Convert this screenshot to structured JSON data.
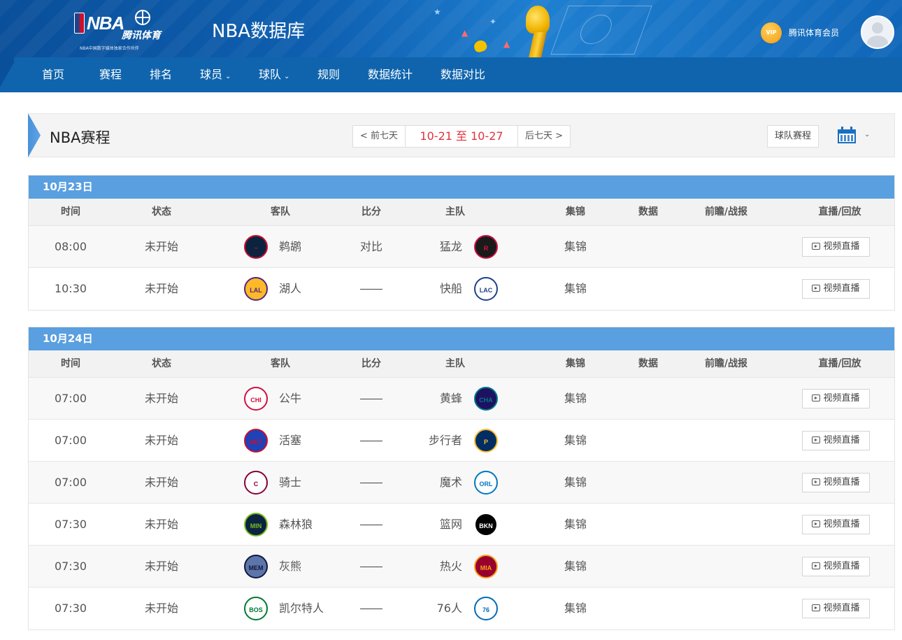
{
  "header": {
    "logo_nba": "NBA",
    "logo_partner": "腾讯体育",
    "logo_sub": "NBA中国数字媒体独家合作伙伴",
    "site_title": "NBA数据库",
    "vip_badge": "VIP",
    "vip_label": "腾讯体育会员"
  },
  "nav": [
    {
      "label": "首页",
      "caret": false
    },
    {
      "label": "赛程",
      "caret": false
    },
    {
      "label": "排名",
      "caret": false
    },
    {
      "label": "球员",
      "caret": true
    },
    {
      "label": "球队",
      "caret": true
    },
    {
      "label": "规则",
      "caret": false
    },
    {
      "label": "数据统计",
      "caret": false
    },
    {
      "label": "数据对比",
      "caret": false
    }
  ],
  "schedule": {
    "title": "NBA赛程",
    "prev_label": "< 前七天",
    "next_label": "后七天 >",
    "range": "10-21 至 10-27",
    "team_schedule_label": "球队赛程"
  },
  "columns": [
    "时间",
    "状态",
    "客队",
    "比分",
    "主队",
    "集锦",
    "数据",
    "前瞻/战报",
    "直播/回放"
  ],
  "days": [
    {
      "date": "10月23日",
      "games": [
        {
          "time": "08:00",
          "status": "未开始",
          "away": "鹈鹕",
          "away_logo": "pelicans-logo",
          "score": "对比",
          "home": "猛龙",
          "home_logo": "raptors-logo",
          "highlights": "集锦",
          "live": "视频直播"
        },
        {
          "time": "10:30",
          "status": "未开始",
          "away": "湖人",
          "away_logo": "lakers-logo",
          "score": "",
          "home": "快船",
          "home_logo": "clippers-logo",
          "highlights": "集锦",
          "live": "视频直播"
        }
      ]
    },
    {
      "date": "10月24日",
      "games": [
        {
          "time": "07:00",
          "status": "未开始",
          "away": "公牛",
          "away_logo": "bulls-logo",
          "score": "",
          "home": "黄蜂",
          "home_logo": "hornets-logo",
          "highlights": "集锦",
          "live": "视频直播"
        },
        {
          "time": "07:00",
          "status": "未开始",
          "away": "活塞",
          "away_logo": "pistons-logo",
          "score": "",
          "home": "步行者",
          "home_logo": "pacers-logo",
          "highlights": "集锦",
          "live": "视频直播"
        },
        {
          "time": "07:00",
          "status": "未开始",
          "away": "骑士",
          "away_logo": "cavaliers-logo",
          "score": "",
          "home": "魔术",
          "home_logo": "magic-logo",
          "highlights": "集锦",
          "live": "视频直播"
        },
        {
          "time": "07:30",
          "status": "未开始",
          "away": "森林狼",
          "away_logo": "timberwolves-logo",
          "score": "",
          "home": "篮网",
          "home_logo": "nets-logo",
          "highlights": "集锦",
          "live": "视频直播"
        },
        {
          "time": "07:30",
          "status": "未开始",
          "away": "灰熊",
          "away_logo": "grizzlies-logo",
          "score": "",
          "home": "热火",
          "home_logo": "heat-logo",
          "highlights": "集锦",
          "live": "视频直播"
        },
        {
          "time": "07:30",
          "status": "未开始",
          "away": "凯尔特人",
          "away_logo": "celtics-logo",
          "score": "",
          "home": "76人",
          "home_logo": "76ers-logo",
          "highlights": "集锦",
          "live": "视频直播"
        }
      ]
    }
  ],
  "team_colors": {
    "鹈鹕": {
      "bg": "#0c2340",
      "fg": "#c8102e",
      "mark": "~"
    },
    "猛龙": {
      "bg": "#1a1a1a",
      "fg": "#ce1141",
      "mark": "R"
    },
    "湖人": {
      "bg": "#fdb927",
      "fg": "#552583",
      "mark": "LAL"
    },
    "快船": {
      "bg": "#ffffff",
      "fg": "#1d428a",
      "mark": "LAC"
    },
    "公牛": {
      "bg": "#ffffff",
      "fg": "#ce1141",
      "mark": "CHI"
    },
    "黄蜂": {
      "bg": "#1d1160",
      "fg": "#00788c",
      "mark": "CHA"
    },
    "活塞": {
      "bg": "#1d42ba",
      "fg": "#c8102e",
      "mark": "DET"
    },
    "步行者": {
      "bg": "#002d62",
      "fg": "#fdbb30",
      "mark": "P"
    },
    "骑士": {
      "bg": "#ffffff",
      "fg": "#860038",
      "mark": "C"
    },
    "魔术": {
      "bg": "#ffffff",
      "fg": "#0077c0",
      "mark": "ORL"
    },
    "森林狼": {
      "bg": "#0c2340",
      "fg": "#78be20",
      "mark": "MIN"
    },
    "篮网": {
      "bg": "#000000",
      "fg": "#ffffff",
      "mark": "BKN"
    },
    "灰熊": {
      "bg": "#5d76a9",
      "fg": "#12173f",
      "mark": "MEM"
    },
    "热火": {
      "bg": "#98002e",
      "fg": "#f9a01b",
      "mark": "MIA"
    },
    "凯尔特人": {
      "bg": "#ffffff",
      "fg": "#007a33",
      "mark": "BOS"
    },
    "76人": {
      "bg": "#ffffff",
      "fg": "#006bb6",
      "mark": "76"
    }
  }
}
